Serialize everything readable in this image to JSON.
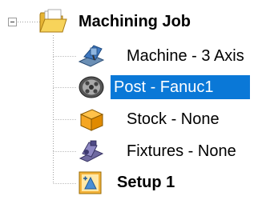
{
  "tree": {
    "root": {
      "label": "Machining Job",
      "icon": "folder-icon",
      "expanded": true
    },
    "children": [
      {
        "label": "Machine - 3 Axis",
        "icon": "machine-icon"
      },
      {
        "label": "Post - Fanuc1",
        "icon": "post-reel-icon",
        "selected": true
      },
      {
        "label": "Stock - None",
        "icon": "stock-box-icon"
      },
      {
        "label": "Fixtures - None",
        "icon": "fixture-clamp-icon"
      },
      {
        "label": "Setup 1",
        "icon": "setup-icon"
      }
    ]
  },
  "colors": {
    "selection": "#0a78d7",
    "folder": "#f2c94c",
    "stock": "#f5a623",
    "machine": "#2f6db5"
  }
}
